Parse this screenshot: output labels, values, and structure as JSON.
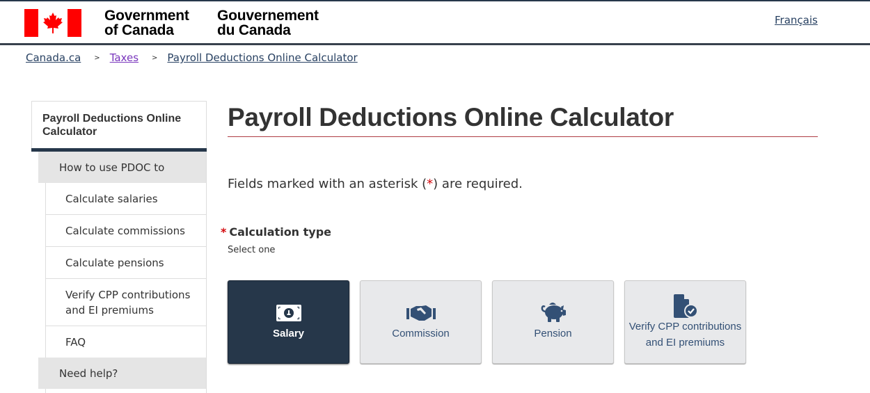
{
  "header": {
    "wordmark_en_line1": "Government",
    "wordmark_en_line2": "of Canada",
    "wordmark_fr_line1": "Gouvernement",
    "wordmark_fr_line2": "du Canada",
    "language_link": "Français",
    "flag_icon": "canada-flag-icon"
  },
  "breadcrumb": [
    {
      "label": "Canada.ca"
    },
    {
      "label": "Taxes"
    },
    {
      "label": "Payroll Deductions Online Calculator"
    }
  ],
  "breadcrumb_separator": ">",
  "sidenav": {
    "title": "Payroll Deductions Online Calculator",
    "group1": "How to use PDOC to",
    "items": [
      {
        "label": "Calculate salaries"
      },
      {
        "label": "Calculate commissions"
      },
      {
        "label": "Calculate pensions"
      },
      {
        "label": "Verify CPP contributions and EI premiums"
      },
      {
        "label": "FAQ"
      }
    ],
    "group2": "Need help?"
  },
  "main": {
    "title": "Payroll Deductions Online Calculator",
    "required_note_before": "Fields marked with an asterisk (",
    "required_note_asterisk": "*",
    "required_note_after": ") are required.",
    "calc_type_asterisk": "*",
    "calc_type_label": "Calculation type",
    "calc_type_hint": "Select one",
    "options": [
      {
        "label": "Salary",
        "icon": "money-bill-icon",
        "selected": true
      },
      {
        "label": "Commission",
        "icon": "handshake-icon",
        "selected": false
      },
      {
        "label": "Pension",
        "icon": "piggy-bank-icon",
        "selected": false
      },
      {
        "label": "Verify CPP contributions and EI premiums",
        "icon": "file-check-icon",
        "selected": false
      }
    ]
  },
  "colors": {
    "brand_dark": "#26374a",
    "link": "#284162",
    "visited_link": "#7834bc",
    "required_red": "#d3080c",
    "h1_rule": "#af3c43",
    "flag_red": "#ff0000"
  }
}
